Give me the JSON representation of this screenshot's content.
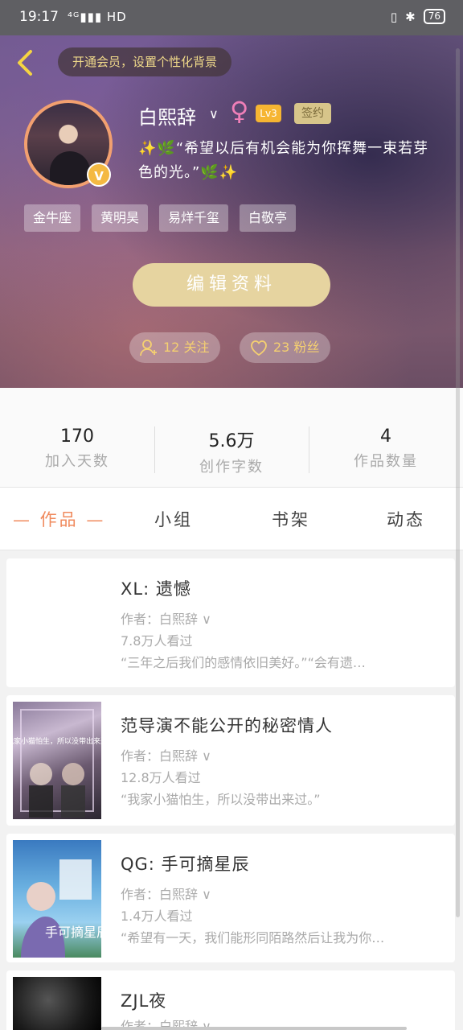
{
  "statusbar": {
    "time": "19:17",
    "network": "⁴ᴳ▮▮▮ HD",
    "battery": "76"
  },
  "header": {
    "vip_prompt": "开通会员，设置个性化背景",
    "username": "白熙辞",
    "level": "Lv3",
    "signed_badge": "签约",
    "bio": "✨🌿“希望以后有机会能为你挥舞一束若芽色的光。”🌿✨",
    "tags": [
      "金牛座",
      "黄明昊",
      "易烊千玺",
      "白敬亭"
    ],
    "edit_button": "编辑资料",
    "following": "12 关注",
    "fans": "23 粉丝",
    "colors": {
      "accent": "#f5d442",
      "edit_button": "#e6d4a0",
      "gender": "#f07fb8"
    }
  },
  "stats": [
    {
      "value": "170",
      "label": "加入天数"
    },
    {
      "value": "5.6万",
      "label": "创作字数"
    },
    {
      "value": "4",
      "label": "作品数量"
    }
  ],
  "tabs": [
    "— 作品 —",
    "小组",
    "书架",
    "动态"
  ],
  "works": [
    {
      "title": "XL:  遗憾",
      "author": "作者：白熙辞 ∨",
      "views": "7.8万人看过",
      "excerpt": "“三年之后我们的感情依旧美好。”“会有遗…",
      "has_cover": false
    },
    {
      "title": "范导演不能公开的秘密情人",
      "author": "作者：白熙辞 ∨",
      "views": "12.8万人看过",
      "excerpt": "“我家小猫怕生，所以没带出来过。”",
      "has_cover": true
    },
    {
      "title": "QG:  手可摘星辰",
      "author": "作者：白熙辞 ∨",
      "views": "1.4万人看过",
      "excerpt": "“希望有一天，我们能形同陌路然后让我为你…",
      "has_cover": true
    },
    {
      "title": "ZJL夜",
      "author": "作者：白熙辞 ∨",
      "views": "",
      "excerpt": "",
      "has_cover": true
    }
  ],
  "covers": {
    "cover2_text": "“我家小猫怕生，所以没带出来过”",
    "cover3_text": "手可摘星辰"
  }
}
